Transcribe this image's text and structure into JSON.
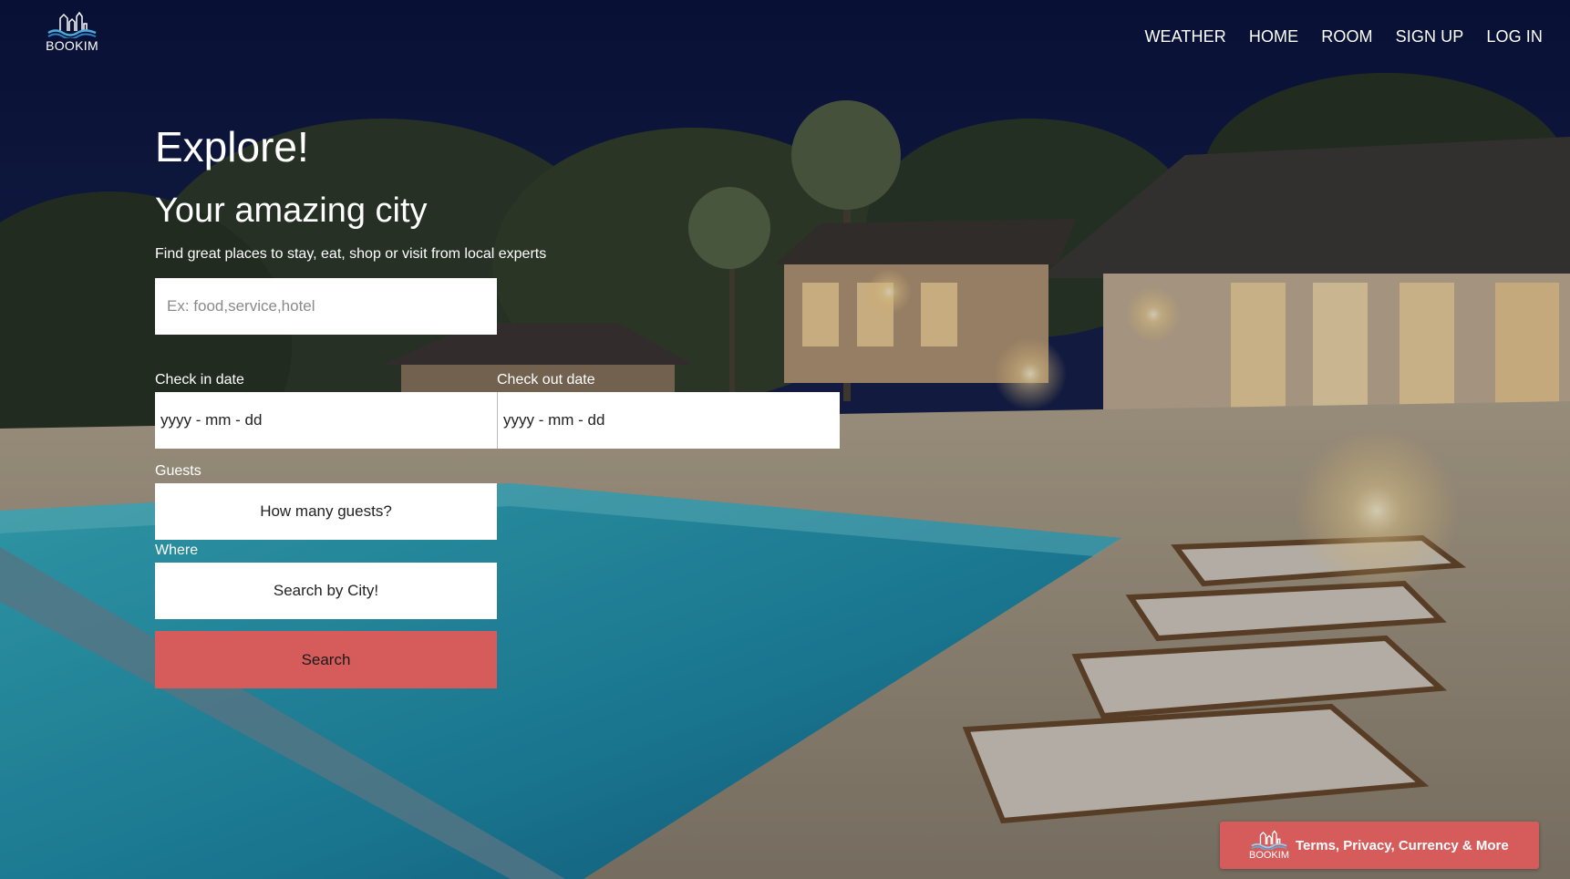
{
  "brand": {
    "logo_text": "BOOKIM"
  },
  "nav": {
    "items": [
      {
        "label": "WEATHER"
      },
      {
        "label": "HOME"
      },
      {
        "label": "ROOM"
      },
      {
        "label": "SIGN UP"
      },
      {
        "label": "LOG IN"
      }
    ]
  },
  "hero": {
    "title": "Explore!",
    "subtitle": "Your amazing city",
    "description": "Find great places to stay, eat, shop or visit from local experts"
  },
  "search": {
    "placeholder": "Ex: food,service,hotel",
    "check_in_label": "Check in date",
    "check_in_value": "yyyy - mm - dd",
    "check_out_label": "Check out date",
    "check_out_value": "yyyy - mm - dd",
    "guests_label": "Guests",
    "guests_value": "How many guests?",
    "where_label": "Where",
    "where_value": "Search by City!",
    "search_button": "Search"
  },
  "footer": {
    "logo_text": "BOOKIM",
    "link_text": "Terms, Privacy, Currency & More"
  },
  "colors": {
    "accent": "#d65b5b",
    "sky": "#0d1640",
    "pool": "#2a9bb0"
  },
  "icons": {
    "logo": "city-buildings-waves-icon"
  }
}
